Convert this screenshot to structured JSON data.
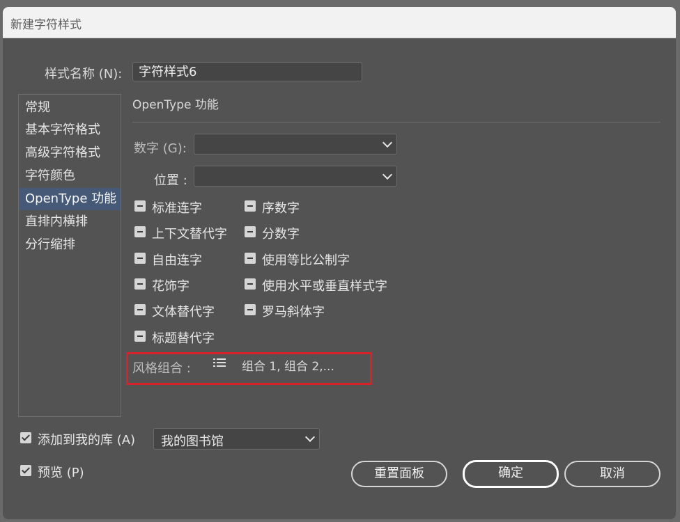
{
  "title": "新建字符样式",
  "style_name": {
    "label": "样式名称 (N):",
    "value": "字符样式6"
  },
  "sidebar": {
    "items": [
      {
        "label": "常规"
      },
      {
        "label": "基本字符格式"
      },
      {
        "label": "高级字符格式"
      },
      {
        "label": "字符颜色"
      },
      {
        "label": "OpenType 功能",
        "active": true
      },
      {
        "label": "直排内横排"
      },
      {
        "label": "分行缩排"
      }
    ]
  },
  "section": {
    "title": "OpenType 功能"
  },
  "numbers": {
    "label": "数字 (G):",
    "value": ""
  },
  "position": {
    "label": "位置 :",
    "value": ""
  },
  "options_left": [
    {
      "label": "标准连字",
      "state": "mixed"
    },
    {
      "label": "上下文替代字",
      "state": "mixed"
    },
    {
      "label": "自由连字",
      "state": "mixed"
    },
    {
      "label": "花饰字",
      "state": "mixed"
    },
    {
      "label": "文体替代字",
      "state": "mixed"
    },
    {
      "label": "标题替代字",
      "state": "mixed"
    }
  ],
  "options_right": [
    {
      "label": "序数字",
      "state": "mixed"
    },
    {
      "label": "分数字",
      "state": "mixed"
    },
    {
      "label": "使用等比公制字",
      "state": "mixed"
    },
    {
      "label": "使用水平或垂直样式字",
      "state": "mixed"
    },
    {
      "label": "罗马斜体字",
      "state": "mixed"
    }
  ],
  "stylistic_sets": {
    "label": "风格组合 :",
    "value": "组合 1, 组合 2,...",
    "icon": "list-icon"
  },
  "add_to_library": {
    "label": "添加到我的库 (A)",
    "checked": true,
    "library": "我的图书馆"
  },
  "preview": {
    "label": "预览 (P)",
    "checked": true
  },
  "buttons": {
    "reset": "重置面板",
    "ok": "确定",
    "cancel": "取消"
  },
  "colors": {
    "dialog_bg": "#535353",
    "active_item": "#465a77",
    "highlight": "#d8222a"
  }
}
